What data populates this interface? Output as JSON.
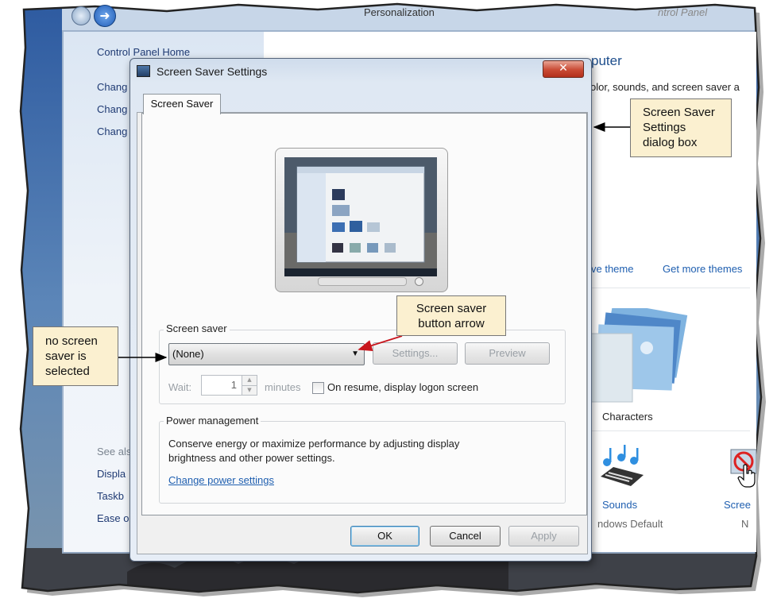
{
  "background_window": {
    "breadcrumb": "Personalization",
    "breadcrumb_right": "ntrol Panel",
    "nav": {
      "home": "Control Panel Home",
      "items": [
        "Chang",
        "Chang",
        "Chang"
      ],
      "see_also": "See als",
      "see_also_items": [
        "Displa",
        "Taskb",
        "Ease o"
      ]
    },
    "content": {
      "heading_partial": "puter",
      "subtext_partial": "olor, sounds, and screen saver a",
      "theme_links": [
        "ve theme",
        "Get more themes"
      ],
      "theme_name": "Characters",
      "sounds_label": "Sounds",
      "sounds_sub": "ndows Default",
      "screensaver_label": "Scree",
      "screensaver_sub": "N"
    }
  },
  "dialog": {
    "title": "Screen Saver Settings",
    "close_symbol": "✕",
    "tab": "Screen Saver",
    "screen_saver_group": {
      "label": "Screen saver",
      "selected": "(None)",
      "settings_button": "Settings...",
      "preview_button": "Preview",
      "wait_label": "Wait:",
      "wait_value": "1",
      "minutes_label": "minutes",
      "resume_checkbox": "On resume, display logon screen"
    },
    "power_group": {
      "label": "Power management",
      "line1": "Conserve energy or maximize performance by adjusting display",
      "line2": "brightness and other power settings.",
      "link": "Change power settings"
    },
    "buttons": {
      "ok": "OK",
      "cancel": "Cancel",
      "apply": "Apply"
    }
  },
  "callouts": {
    "dialog_box": [
      "Screen Saver",
      "Settings",
      "dialog box"
    ],
    "button_arrow": [
      "Screen saver",
      "button arrow"
    ],
    "none_selected": [
      "no screen",
      "saver is",
      "selected"
    ]
  },
  "colors": {
    "callout_fill": "#fbf0d0",
    "arrow_red": "#c8161d",
    "link_blue": "#1f5fb0",
    "close_red": "#c94a34"
  },
  "icons": [
    "back-icon",
    "forward-icon",
    "close-icon",
    "dropdown-arrow-icon",
    "spinner-up-icon",
    "spinner-down-icon",
    "sounds-music-icon",
    "screensaver-no-icon",
    "hand-cursor-icon"
  ]
}
